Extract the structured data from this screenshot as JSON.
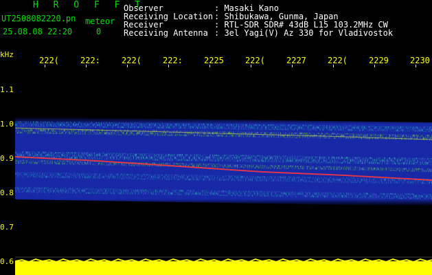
{
  "header": {
    "station_code": "H R O F F T",
    "filename": "UT2508082220.pn",
    "mode": "meteor",
    "datetime": "25.08.08 22:20",
    "count": "0",
    "fields": [
      {
        "label": "Observer",
        "value": ": Masaki Kano"
      },
      {
        "label": "Receiving Location",
        "value": ": Shibukawa, Gunma, Japan"
      },
      {
        "label": "Receiver",
        "value": ": RTL-SDR SDR# 43dB L15 103.2MHz CW"
      },
      {
        "label": "Receiving Antenna",
        "value": ": 3el Yagi(V) Az 330 for Vladivostok"
      }
    ]
  },
  "time_axis": {
    "labels": [
      "222(",
      "222:",
      "222(",
      "222:",
      "2225",
      "222(",
      "2227",
      "222(",
      "2229",
      "2230"
    ]
  },
  "freq_axis": {
    "unit": "kHz",
    "labels": [
      "1.1",
      "1.0",
      "0.9",
      "0.8",
      "0.7",
      "0.6"
    ]
  },
  "colors": {
    "text_green": "#00e000",
    "text_white": "#ffffff",
    "tick_yellow": "#ffff00",
    "noise_floor": "#ffff00",
    "band_blue": "#2030c0",
    "band_cyan": "#40c0c0",
    "band_green": "#80d040",
    "band_red": "#ff4040"
  }
}
